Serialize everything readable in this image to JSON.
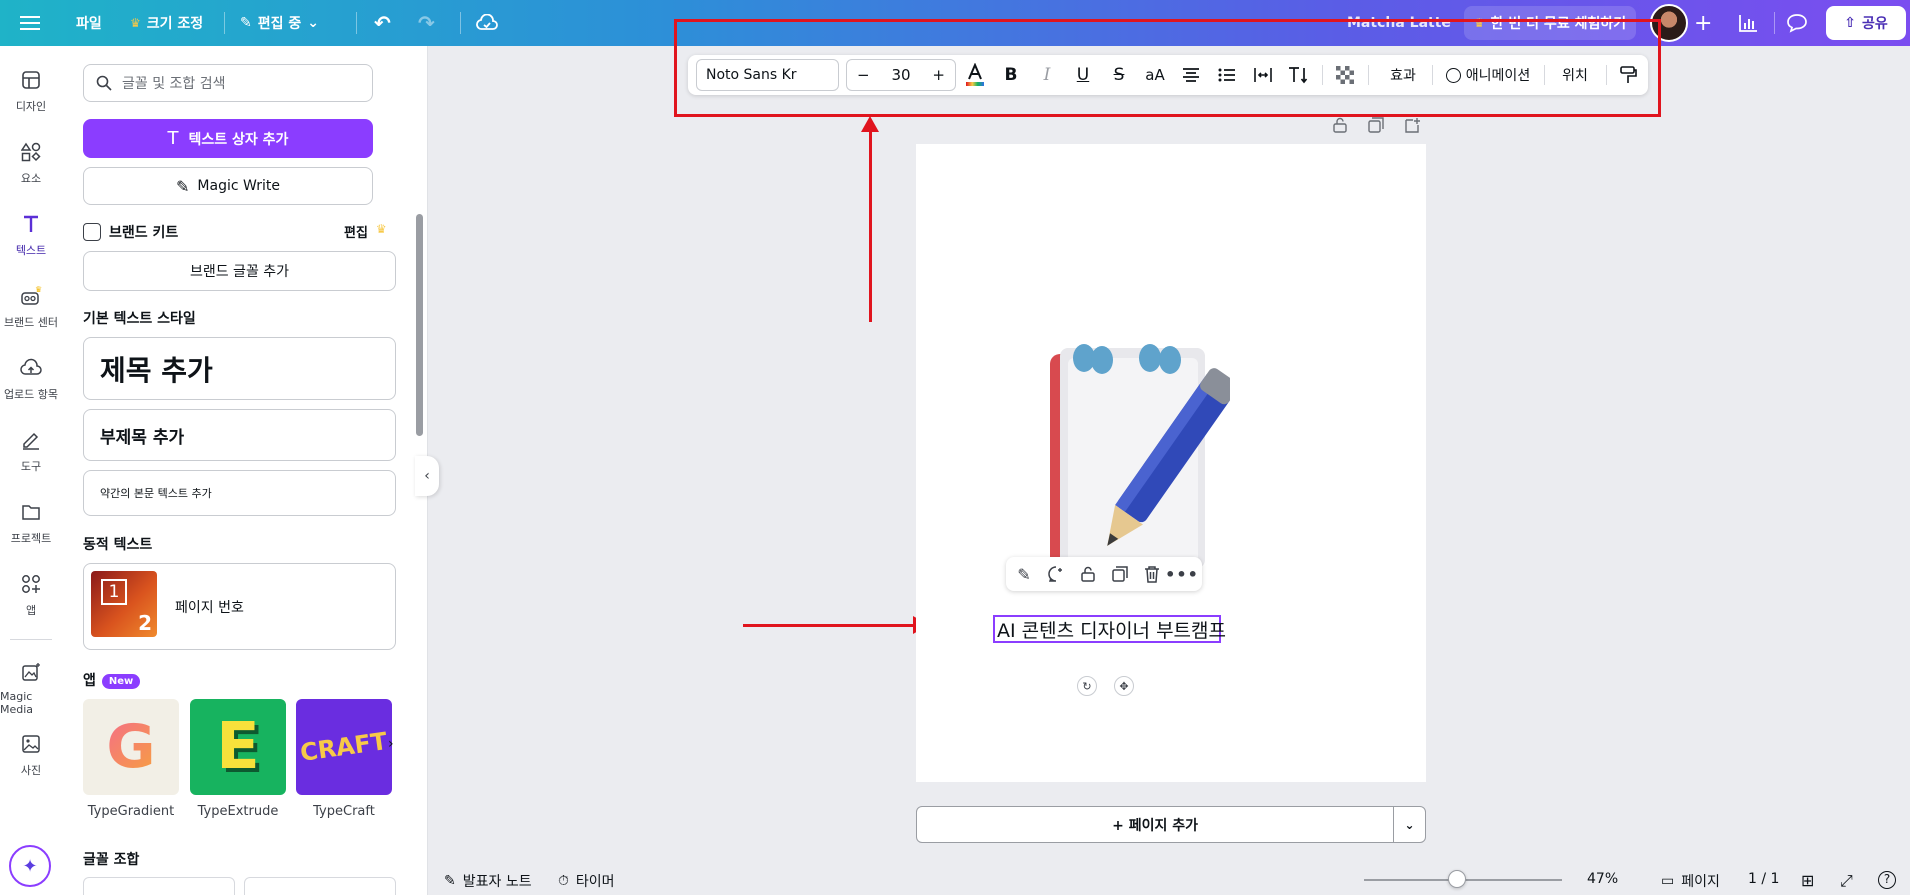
{
  "topbar": {
    "file": "파일",
    "resize": "크기 조정",
    "editing": "편집 중",
    "project_name": "Matcha Latte",
    "trial": "한 번 더 무료 체험하기",
    "share": "공유"
  },
  "rail": {
    "items": [
      {
        "label": "디자인",
        "icon": "layout-icon"
      },
      {
        "label": "요소",
        "icon": "shapes-icon"
      },
      {
        "label": "텍스트",
        "icon": "text-icon"
      },
      {
        "label": "브랜드 센터",
        "icon": "brand-icon"
      },
      {
        "label": "업로드 항목",
        "icon": "upload-cloud-icon"
      },
      {
        "label": "도구",
        "icon": "pen-icon"
      },
      {
        "label": "프로젝트",
        "icon": "folder-icon"
      },
      {
        "label": "앱",
        "icon": "apps-icon"
      },
      {
        "label": "Magic Media",
        "icon": "magic-media-icon"
      },
      {
        "label": "사진",
        "icon": "photo-icon"
      }
    ]
  },
  "panel": {
    "search_placeholder": "글꼴 및 조합 검색",
    "add_textbox": "텍스트 상자 추가",
    "magic_write": "Magic Write",
    "brand_kit": "브랜드 키트",
    "brand_edit": "편집",
    "add_brand_font": "브랜드 글꼴 추가",
    "basic_styles_title": "기본 텍스트 스타일",
    "heading": "제목 추가",
    "subheading": "부제목 추가",
    "body": "약간의 본문 텍스트 추가",
    "dynamic_title": "동적 텍스트",
    "page_number": "페이지 번호",
    "dyn_thumb_a": "1",
    "dyn_thumb_b": "2",
    "apps_title": "앱",
    "new_badge": "New",
    "apps": [
      {
        "name": "TypeGradient",
        "glyph": "G"
      },
      {
        "name": "TypeExtrude",
        "glyph": "E"
      },
      {
        "name": "TypeCraft",
        "glyph": "CRAFT"
      }
    ],
    "font_pairs_title": "글꼴 조합"
  },
  "toolbar": {
    "font": "Noto Sans Kr",
    "size": "30",
    "minus": "−",
    "plus": "+",
    "case": "aA",
    "effects": "효과",
    "animate": "애니메이션",
    "position": "위치"
  },
  "canvas": {
    "text": "AI 콘텐츠 디자이너 부트캠프",
    "add_page": "+ 페이지 추가"
  },
  "bottom": {
    "notes": "발표자 노트",
    "timer": "타이머",
    "zoom": "47%",
    "zoom_level": 0.47,
    "pages": "페이지",
    "page_count": "1 / 1"
  },
  "colors": {
    "accent": "#8b3dff",
    "annotation": "#e0141e"
  }
}
